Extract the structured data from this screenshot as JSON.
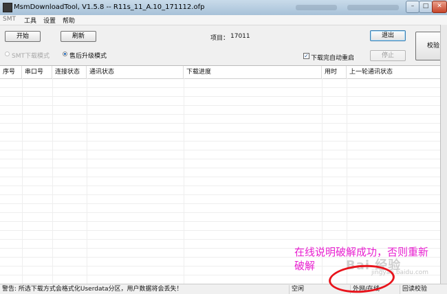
{
  "window": {
    "title": "MsmDownloadTool, V1.5.8 -- R11s_11_A.10_171112.ofp",
    "controls": [
      "–",
      "□",
      "✕"
    ]
  },
  "menu": [
    "SMT",
    "工具",
    "设置",
    "帮助"
  ],
  "toolbar": {
    "start_label": "开始",
    "refresh_label": "刷新",
    "project_label": "项目：",
    "project_value": "17011",
    "exit_label": "退出",
    "verify_label": "校验",
    "stop_label": "停止",
    "mode_smt_label": "SMT下载模式",
    "mode_aftersale_label": "售后升级模式",
    "auto_reboot_label": "下载完自动重启",
    "auto_reboot_checked": true
  },
  "table": {
    "columns": [
      "序号",
      "串口号",
      "连接状态",
      "通讯状态",
      "下载进度",
      "用时",
      "上一轮通讯状态"
    ]
  },
  "statusbar": {
    "warning": "警告: 所选下载方式会格式化Userdata分区，用户数据将会丢失！",
    "idle": "空闲",
    "network": "外网/在线",
    "readback": "回读校验"
  },
  "annotation": {
    "line1": "在线说明破解成功，否则重新",
    "line2": "破解",
    "highlight_color": "#e8141c",
    "text_color": "#e81fd0"
  },
  "watermark": {
    "text": "Bai 经验",
    "sub": "jingyan.baidu.com"
  }
}
